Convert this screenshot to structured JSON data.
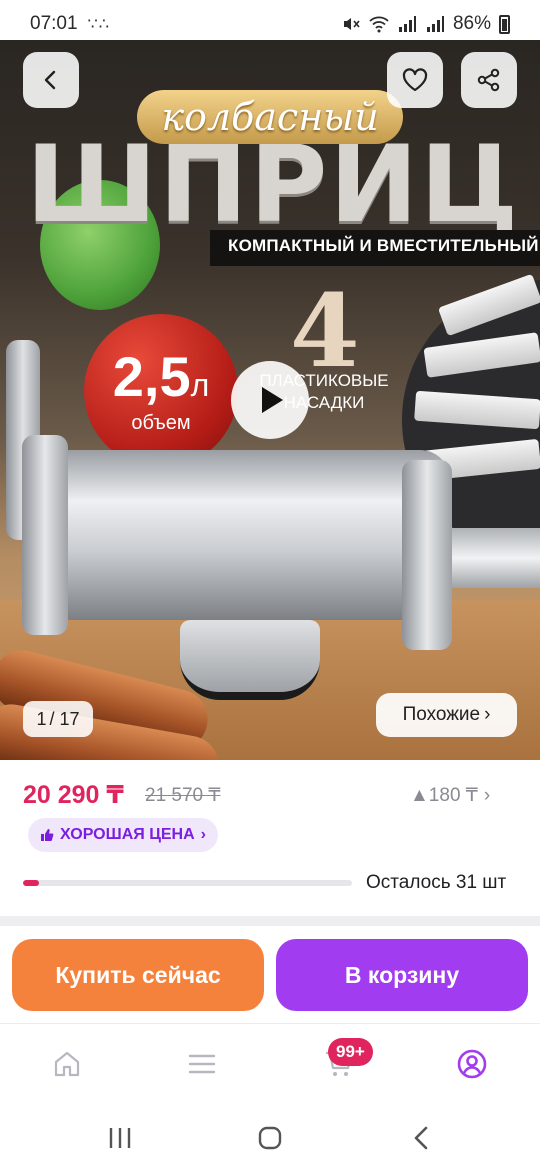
{
  "status_bar": {
    "time": "07:01",
    "extra": "∵∴",
    "battery": "86%"
  },
  "hero": {
    "brand_script": "колбасный",
    "title": "ШПРИЦ",
    "subtitle": "КОМПАКТНЫЙ И ВМЕСТИТЕЛЬНЫЙ",
    "volume_value": "2,5",
    "volume_unit": "л",
    "volume_label": "объем",
    "nozzles_count": "4",
    "nozzles_label": "ПЛАСТИКОВЫЕ НАСАДКИ",
    "image_current": "1",
    "image_total": "/ 17",
    "similar_label": "Похожие",
    "similar_chevron": "›"
  },
  "price": {
    "current": "20 290 ₸",
    "old": "21 570 ₸",
    "delta": "▲180 ₸",
    "delta_chevron": "›",
    "badge_label": "ХОРОШАЯ ЦЕНА",
    "badge_chevron": "›",
    "stock_text": "Осталось 31 шт",
    "stock_fraction": 0.05
  },
  "actions": {
    "buy_now": "Купить сейчас",
    "add_to_cart": "В корзину"
  },
  "bottom_nav": {
    "items": [
      "home-icon",
      "catalog-icon",
      "cart-icon",
      "profile-icon"
    ],
    "cart_badge": "99+",
    "active": "profile"
  },
  "colors": {
    "accent_pink": "#e0245e",
    "buy_orange": "#f5823c",
    "cart_purple": "#a13cf0",
    "badge_bg": "#f1e7fb"
  }
}
